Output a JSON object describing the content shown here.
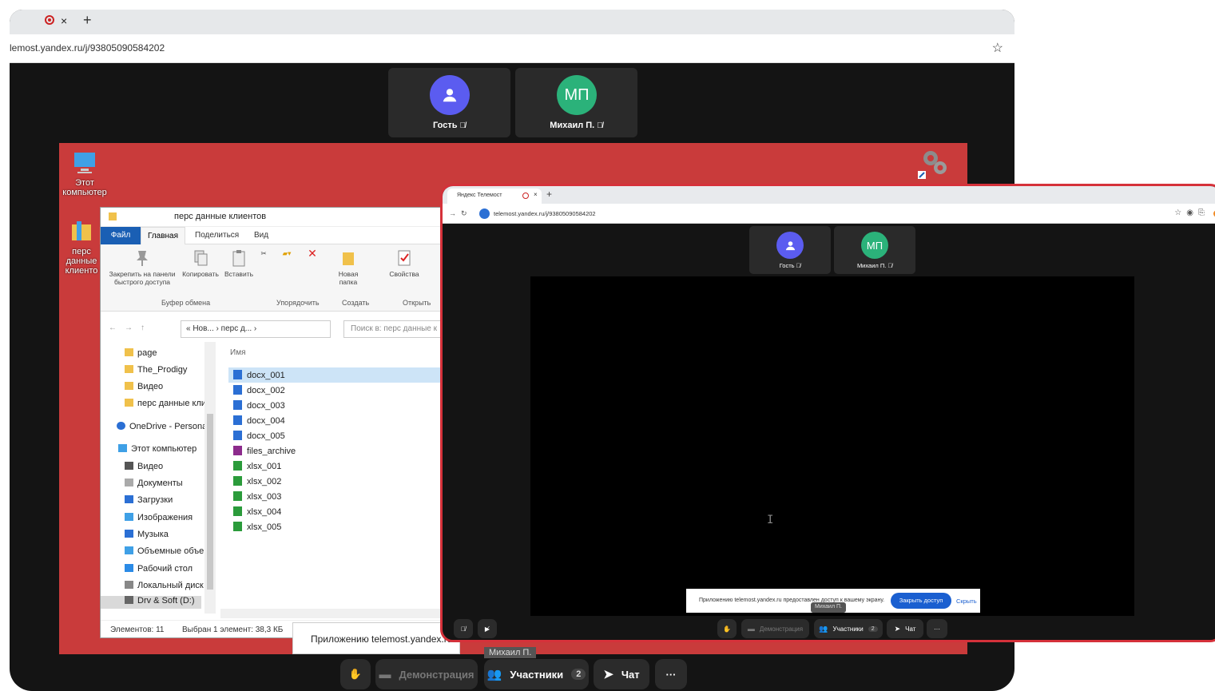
{
  "main_browser": {
    "url": "lemost.yandex.ru/j/93805090584202",
    "tab_close": "×",
    "tab_new": "+"
  },
  "participants": [
    {
      "initials": "",
      "name": "Гость"
    },
    {
      "initials": "МП",
      "name": "Михаил П."
    }
  ],
  "desktop": {
    "icons": [
      {
        "label": "Этот компьютер"
      },
      {
        "label": "перс данные клиенто"
      }
    ]
  },
  "explorer": {
    "title": "перс данные клиентов",
    "menu": [
      "Файл",
      "Главная",
      "Поделиться",
      "Вид"
    ],
    "ribbon": {
      "pin": "Закрепить на панели быстрого доступа",
      "copy": "Копировать",
      "paste": "Вставить",
      "new_folder": "Новая папка",
      "properties": "Свойства",
      "groups": [
        "Буфер обмена",
        "Упорядочить",
        "Создать",
        "Открыть"
      ]
    },
    "path": "« Нов... › перс д... ›",
    "search_placeholder": "Поиск в: перс данные к",
    "nav_items": [
      "page",
      "The_Prodigy",
      "Видео",
      "перс данные клие",
      "OneDrive - Persona",
      "Этот компьютер",
      "Видео",
      "Документы",
      "Загрузки",
      "Изображения",
      "Музыка",
      "Объемные объек",
      "Рабочий стол",
      "Локальный диск (",
      "Drv & Soft (D:)"
    ],
    "column_header": "Имя",
    "files": [
      {
        "name": "docx_001",
        "type": "docx"
      },
      {
        "name": "docx_002",
        "type": "docx"
      },
      {
        "name": "docx_003",
        "type": "docx"
      },
      {
        "name": "docx_004",
        "type": "docx"
      },
      {
        "name": "docx_005",
        "type": "docx"
      },
      {
        "name": "files_archive",
        "type": "rar"
      },
      {
        "name": "xlsx_001",
        "type": "xlsx"
      },
      {
        "name": "xlsx_002",
        "type": "xlsx"
      },
      {
        "name": "xlsx_003",
        "type": "xlsx"
      },
      {
        "name": "xlsx_004",
        "type": "xlsx"
      },
      {
        "name": "xlsx_005",
        "type": "xlsx"
      }
    ],
    "status_count": "Элементов: 11",
    "status_selected": "Выбран 1 элемент: 38,3 КБ"
  },
  "share_notice_main": "Приложению telemost.yandex.ru пр",
  "presenter_main": "Михаил П.",
  "controls": {
    "demo": "Демонстрация",
    "participants": "Участники",
    "participants_count": "2",
    "chat": "Чат",
    "more": "···"
  },
  "front_browser": {
    "tab_title": "Яндекс Телемост",
    "url": "telemost.yandex.ru/j/93805090584202",
    "share_notice": "Приложению telemost.yandex.ru предоставлен доступ к вашему экрану.",
    "stop_sharing": "Закрыть доступ",
    "hide": "Скрыть",
    "presenter": "Михаил П.",
    "cursor_glyph": "I"
  },
  "colors": {
    "guest_avatar": "#5b5cf0",
    "mp_avatar": "#2bb27a",
    "desktop": "#c93b3b",
    "highlight_border": "#d5313a"
  }
}
